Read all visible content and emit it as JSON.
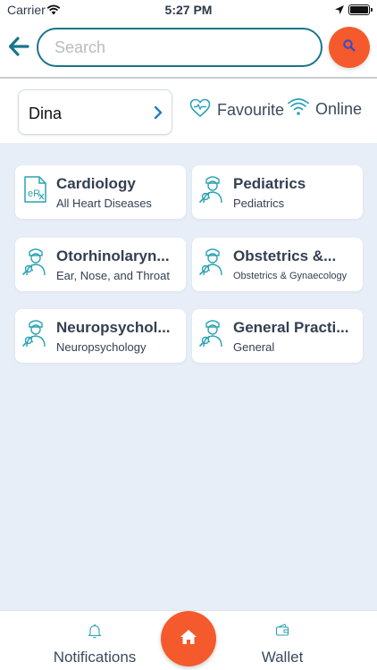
{
  "status_bar": {
    "carrier": "Carrier",
    "time": "5:27 PM"
  },
  "search": {
    "placeholder": "Search",
    "value": ""
  },
  "filter": {
    "selected_name": "Dina",
    "favourite_label": "Favourite",
    "online_label": "Online"
  },
  "specialties": [
    {
      "title": "Cardiology",
      "subtitle": "All Heart Diseases",
      "icon": "prescription-icon"
    },
    {
      "title": "Pediatrics",
      "subtitle": "Pediatrics",
      "icon": "doctor-icon"
    },
    {
      "title": "Otorhinolaryn...",
      "subtitle": "Ear, Nose, and Throat",
      "icon": "doctor-icon"
    },
    {
      "title": "Obstetrics &...",
      "subtitle": "Obstetrics & Gynaecology",
      "icon": "doctor-icon"
    },
    {
      "title": "Neuropsychol...",
      "subtitle": "Neuropsychology",
      "icon": "doctor-icon"
    },
    {
      "title": "General Practi...",
      "subtitle": "General",
      "icon": "doctor-icon"
    }
  ],
  "tabbar": {
    "notifications_label": "Notifications",
    "wallet_label": "Wallet"
  },
  "colors": {
    "accent_orange": "#f55a2c",
    "teal": "#19758a",
    "background": "#e8eef8"
  }
}
